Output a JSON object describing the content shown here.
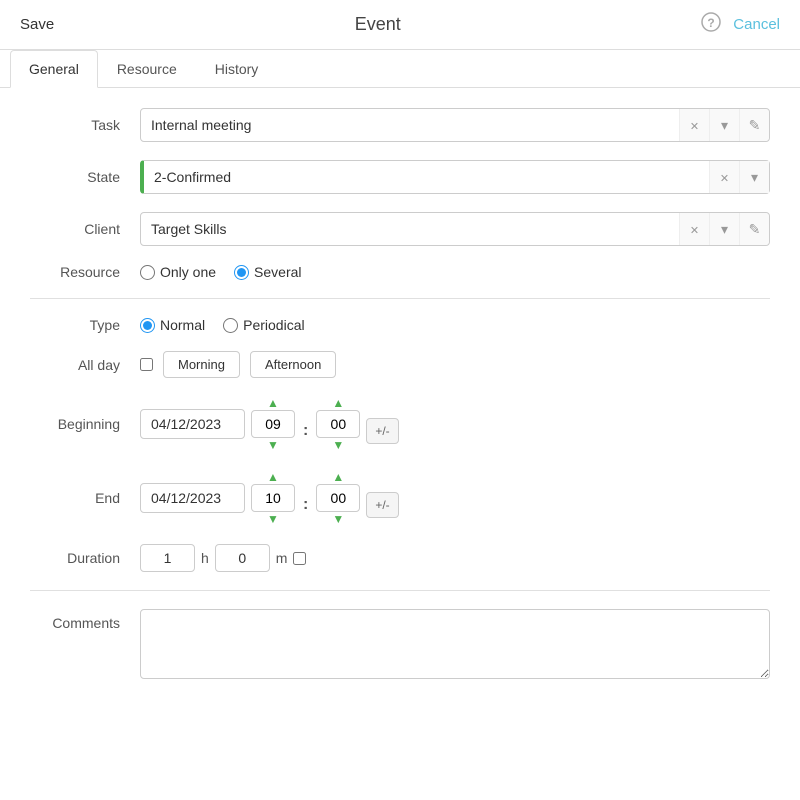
{
  "header": {
    "save_label": "Save",
    "title": "Event",
    "cancel_label": "Cancel"
  },
  "tabs": [
    {
      "id": "general",
      "label": "General",
      "active": true
    },
    {
      "id": "resource",
      "label": "Resource",
      "active": false
    },
    {
      "id": "history",
      "label": "History",
      "active": false
    }
  ],
  "form": {
    "task": {
      "label": "Task",
      "value": "Internal meeting",
      "placeholder": ""
    },
    "state": {
      "label": "State",
      "value": "2-Confirmed"
    },
    "client": {
      "label": "Client",
      "value": "Target Skills"
    },
    "resource": {
      "label": "Resource",
      "options": [
        {
          "id": "only_one",
          "label": "Only one"
        },
        {
          "id": "several",
          "label": "Several"
        }
      ],
      "selected": "several"
    },
    "type": {
      "label": "Type",
      "options": [
        {
          "id": "normal",
          "label": "Normal"
        },
        {
          "id": "periodical",
          "label": "Periodical"
        }
      ],
      "selected": "normal"
    },
    "all_day": {
      "label": "All day",
      "checked": false,
      "morning_label": "Morning",
      "afternoon_label": "Afternoon"
    },
    "beginning": {
      "label": "Beginning",
      "date": "04/12/2023",
      "hours": "09",
      "minutes": "00",
      "plusminus_label": "+/-"
    },
    "end": {
      "label": "End",
      "date": "04/12/2023",
      "hours": "10",
      "minutes": "00",
      "plusminus_label": "+/-"
    },
    "duration": {
      "label": "Duration",
      "hours": "1",
      "h_unit": "h",
      "minutes": "0",
      "m_unit": "m"
    },
    "comments": {
      "label": "Comments",
      "value": "",
      "placeholder": ""
    }
  }
}
